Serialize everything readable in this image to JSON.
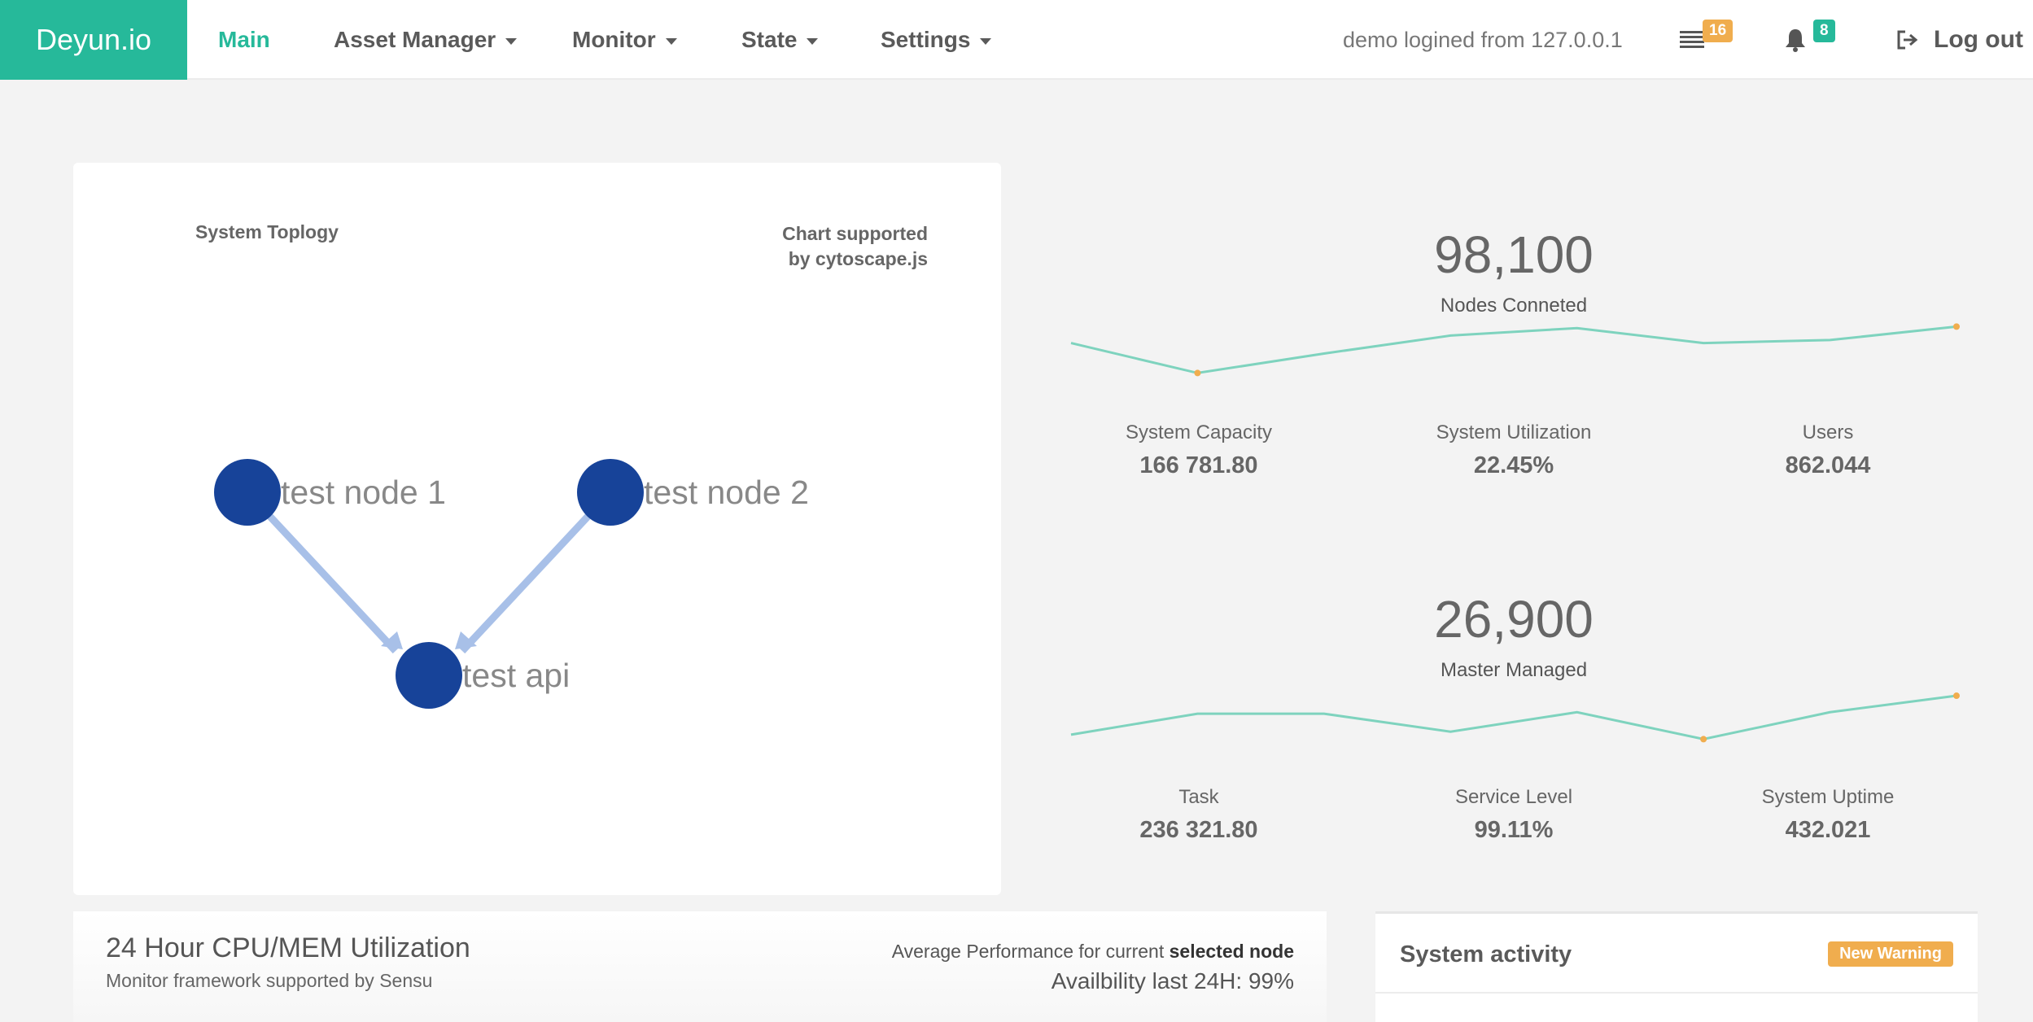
{
  "navbar": {
    "brand": "Deyun.io",
    "items": [
      {
        "label": "Main",
        "dropdown": false,
        "active": true
      },
      {
        "label": "Asset Manager",
        "dropdown": true
      },
      {
        "label": "Monitor",
        "dropdown": true
      },
      {
        "label": "State",
        "dropdown": true
      },
      {
        "label": "Settings",
        "dropdown": true
      }
    ],
    "login_text": "demo logined from 127.0.0.1",
    "messages_icon": "list-icon",
    "messages_badge": "16",
    "notifications_icon": "bell-icon",
    "notifications_badge": "8",
    "logout_icon": "sign-out-icon",
    "logout_label": "Log out"
  },
  "topology": {
    "title": "System Toplogy",
    "credit_line1": "Chart supported",
    "credit_line2": "by cytoscape.js",
    "nodes": [
      {
        "id": "n1",
        "label": "test node 1"
      },
      {
        "id": "n2",
        "label": "test node 2"
      },
      {
        "id": "api",
        "label": "test api"
      }
    ],
    "edges": [
      {
        "from": "n1",
        "to": "api"
      },
      {
        "from": "n2",
        "to": "api"
      }
    ]
  },
  "stats": [
    {
      "value": "98,100",
      "label": "Nodes Conneted",
      "sparkline": [
        3.5,
        1.5,
        2.8,
        4.0,
        4.5,
        3.5,
        3.7,
        4.6
      ],
      "highlight_points": [
        1,
        7
      ],
      "metrics": [
        {
          "label": "System Capacity",
          "value": "166 781.80"
        },
        {
          "label": "System Utilization",
          "value": "22.45%"
        },
        {
          "label": "Users",
          "value": "862.044"
        }
      ]
    },
    {
      "value": "26,900",
      "label": "Master Managed",
      "sparkline": [
        1.8,
        3.2,
        3.2,
        2.0,
        3.3,
        1.5,
        3.3,
        4.4
      ],
      "highlight_points": [
        5,
        7
      ],
      "metrics": [
        {
          "label": "Task",
          "value": "236 321.80"
        },
        {
          "label": "Service Level",
          "value": "99.11%"
        },
        {
          "label": "System Uptime",
          "value": "432.021"
        }
      ]
    }
  ],
  "colors": {
    "brand": "#26b99a",
    "sparkline": "#7ed3be",
    "spark_point": "#f0ad4e",
    "node": "#174399",
    "edge": "#a8c0e8",
    "badge_orange": "#f0ad4e",
    "badge_green": "#26b99a"
  },
  "cpu_panel": {
    "title": "24 Hour CPU/MEM Utilization",
    "subtitle": "Monitor framework supported by Sensu",
    "perf_prefix": "Average Performance for current ",
    "perf_bold": "selected node",
    "availability": "Availbility last 24H: 99%"
  },
  "activity": {
    "title": "System activity",
    "badge": "New Warning"
  }
}
